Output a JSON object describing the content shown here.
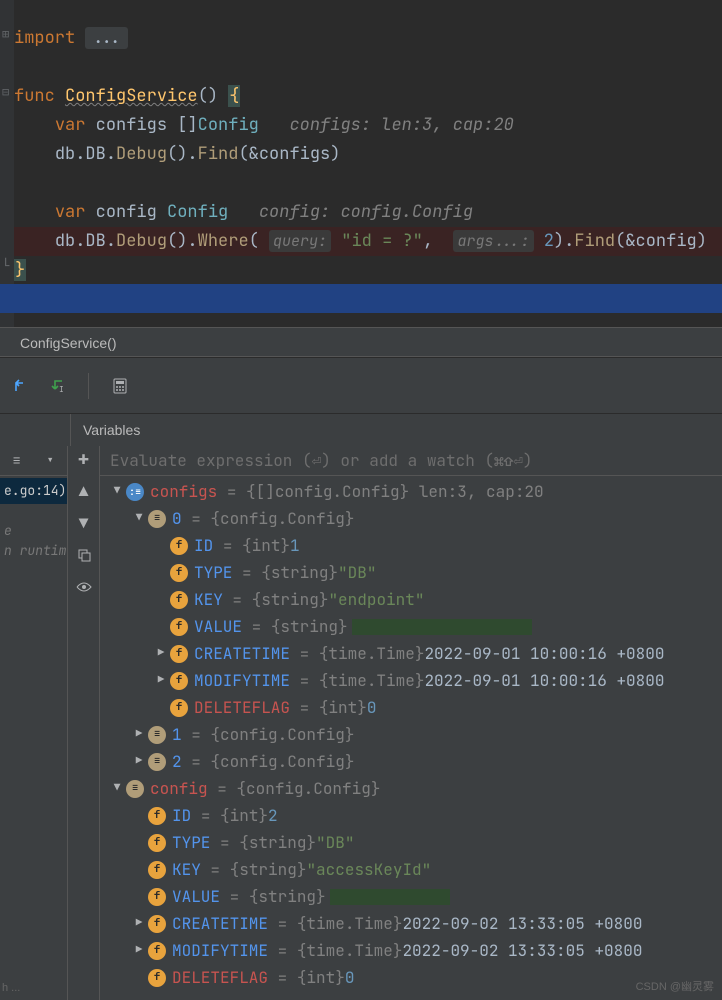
{
  "editor": {
    "import_kw": "import",
    "func_kw": "func",
    "func_name": "ConfigService",
    "parens": "()",
    "open_brace": "{",
    "close_brace": "}",
    "var_kw": "var",
    "var1_name": "configs",
    "var1_type_prefix": "[]",
    "var1_type": "Config",
    "var1_hint": "configs: len:3, cap:20",
    "line_db1_a": "db",
    "line_db1_b": "DB",
    "line_db1_c": "Debug",
    "line_db1_d": "Find",
    "line_db1_arg": "(&configs)",
    "var2_name": "config",
    "var2_type": "Config",
    "var2_hint": "config: config.Config",
    "line_db2_a": "db",
    "line_db2_b": "DB",
    "line_db2_c": "Debug",
    "line_db2_d": "Where",
    "hint_query": "query:",
    "arg_query": "\"id = ?\"",
    "hint_args": "args...:",
    "arg_args": "2",
    "line_db2_e": "Find",
    "line_db2_arg": "(&config)"
  },
  "crumbs": {
    "text": "ConfigService()"
  },
  "debug": {
    "variables_tab": "Variables",
    "eval_placeholder": "Evaluate expression (⏎) or add a watch (⌘⇧⏎)"
  },
  "frames": {
    "selected": "e.go:14)",
    "gray1": "e",
    "gray2": "n runtime"
  },
  "tree": {
    "configs": {
      "name": "configs",
      "val": "= {[]config.Config} len:3, cap:20",
      "items": [
        {
          "idx": "0",
          "val": "= {config.Config}",
          "expanded": true,
          "fields": {
            "ID": {
              "name": "ID",
              "type": "= {int} ",
              "val": "1"
            },
            "TYPE": {
              "name": "TYPE",
              "type": "= {string} ",
              "val": "\"DB\""
            },
            "KEY": {
              "name": "KEY",
              "type": "= {string} ",
              "val": "\"endpoint\""
            },
            "VALUE": {
              "name": "VALUE",
              "type": "= {string}",
              "val": ""
            },
            "CREATETIME": {
              "name": "CREATETIME",
              "type": "= {time.Time} ",
              "val": "2022-09-01 10:00:16 +0800"
            },
            "MODIFYTIME": {
              "name": "MODIFYTIME",
              "type": "= {time.Time} ",
              "val": "2022-09-01 10:00:16 +0800"
            },
            "DELETEFLAG": {
              "name": "DELETEFLAG",
              "type": "= {int} ",
              "val": "0"
            }
          }
        },
        {
          "idx": "1",
          "val": "= {config.Config}",
          "expanded": false
        },
        {
          "idx": "2",
          "val": "= {config.Config}",
          "expanded": false
        }
      ]
    },
    "config": {
      "name": "config",
      "val": "= {config.Config}",
      "fields": {
        "ID": {
          "name": "ID",
          "type": "= {int} ",
          "val": "2"
        },
        "TYPE": {
          "name": "TYPE",
          "type": "= {string} ",
          "val": "\"DB\""
        },
        "KEY": {
          "name": "KEY",
          "type": "= {string} ",
          "val": "\"accessKeyId\""
        },
        "VALUE": {
          "name": "VALUE",
          "type": "= {string}",
          "val": ""
        },
        "CREATETIME": {
          "name": "CREATETIME",
          "type": "= {time.Time} ",
          "val": "2022-09-02 13:33:05 +0800"
        },
        "MODIFYTIME": {
          "name": "MODIFYTIME",
          "type": "= {time.Time} ",
          "val": "2022-09-02 13:33:05 +0800"
        },
        "DELETEFLAG": {
          "name": "DELETEFLAG",
          "type": "= {int} ",
          "val": "0"
        }
      }
    }
  },
  "watermark": "CSDN @幽灵雾",
  "watermark2": "h ..."
}
